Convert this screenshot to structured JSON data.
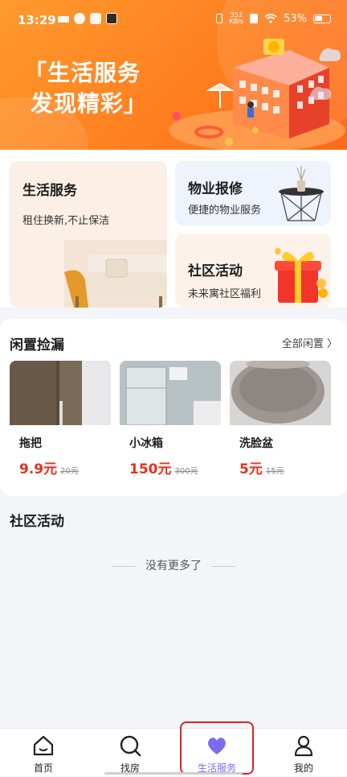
{
  "status_bar": {
    "time": "13:29",
    "net_speed_value": "352",
    "net_speed_unit": "KB/s",
    "battery": "53%"
  },
  "banner": {
    "line1": "「生活服务",
    "line2": "发现精彩」"
  },
  "services": {
    "life": {
      "title": "生活服务",
      "subtitle": "租住换新,不止保洁"
    },
    "repair": {
      "title": "物业报修",
      "subtitle": "便捷的物业服务"
    },
    "event": {
      "title": "社区活动",
      "subtitle": "未来寓社区福利"
    }
  },
  "idle": {
    "title": "闲置捡漏",
    "all_label": "全部闲置 〉",
    "items": [
      {
        "name": "拖把",
        "price": "9.9元",
        "original": "20元"
      },
      {
        "name": "小冰箱",
        "price": "150元",
        "original": "300元"
      },
      {
        "name": "洗脸盆",
        "price": "5元",
        "original": "15元"
      }
    ]
  },
  "community": {
    "title": "社区活动",
    "no_more": "没有更多了"
  },
  "tabbar": {
    "tabs": [
      {
        "label": "首页"
      },
      {
        "label": "找房"
      },
      {
        "label": "生活服务"
      },
      {
        "label": "我的"
      }
    ],
    "active": 2,
    "active_color": "#7a6cf0",
    "highlight_color": "#d8232a"
  },
  "colors": {
    "banner_orange": "#ff7f1f",
    "price_red": "#e8301e"
  }
}
